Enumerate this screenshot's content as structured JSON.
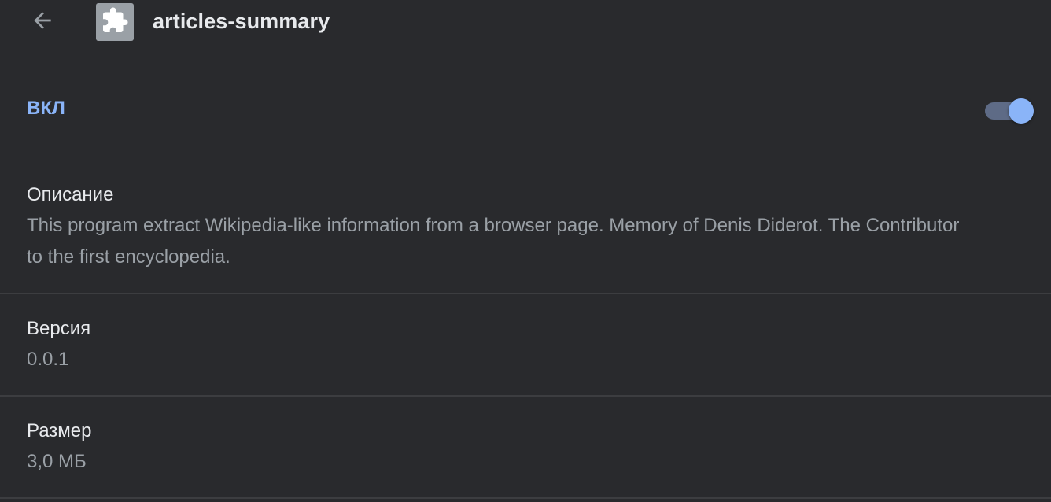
{
  "header": {
    "title": "articles-summary",
    "back_icon": "arrow-left-icon",
    "extension_icon": "puzzle-piece-icon"
  },
  "enabled": {
    "label": "ВКЛ",
    "state": true
  },
  "description": {
    "label": "Описание",
    "value": "This program extract Wikipedia-like information from a browser page. Memory of Denis Diderot. The Contributor to the first encyclopedia."
  },
  "version": {
    "label": "Версия",
    "value": "0.0.1"
  },
  "size": {
    "label": "Размер",
    "value": "3,0 МБ"
  },
  "colors": {
    "background": "#292a2d",
    "accent": "#8ab4f8",
    "text_primary": "#e8eaed",
    "text_secondary": "#9aa0a6"
  }
}
